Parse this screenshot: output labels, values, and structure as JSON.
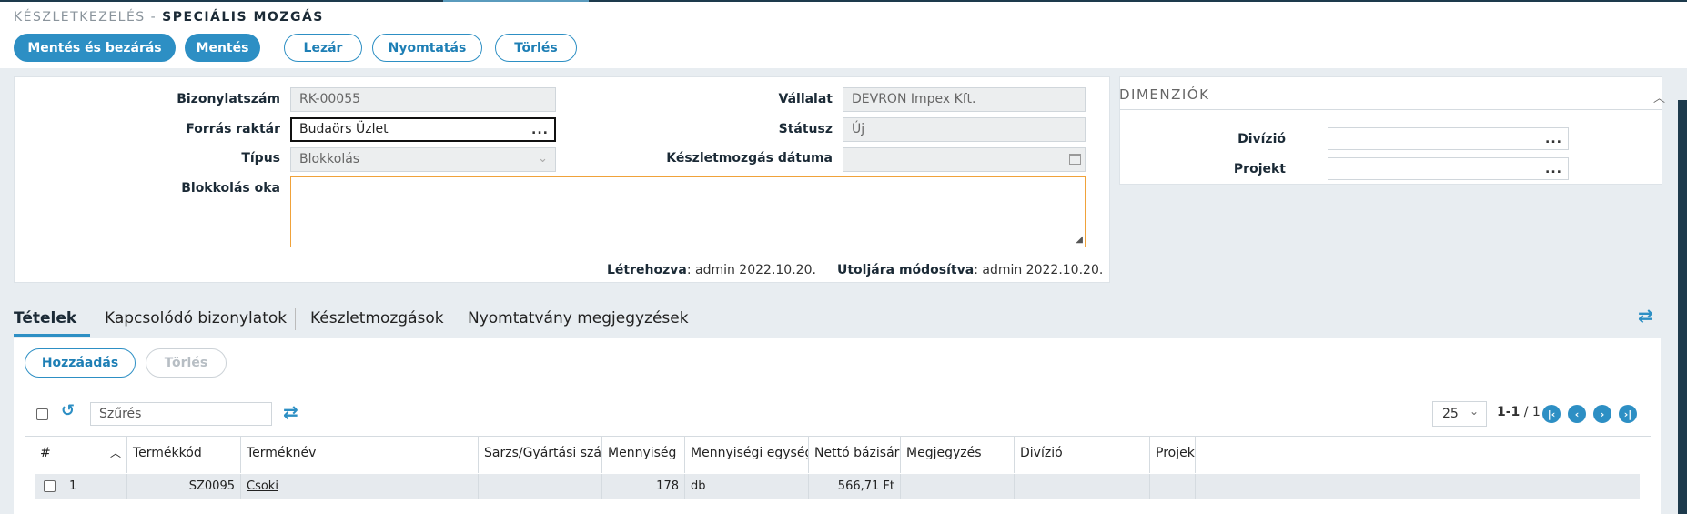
{
  "header": {
    "breadcrumb": "KÉSZLETKEZELÉS -",
    "title": "SPECIÁLIS MOZGÁS"
  },
  "toolbar": {
    "save_close": "Mentés és bezárás",
    "save": "Mentés",
    "close_doc": "Lezár",
    "print": "Nyomtatás",
    "delete": "Törlés"
  },
  "form": {
    "doc_number_label": "Bizonylatszám",
    "doc_number_value": "RK-00055",
    "source_wh_label": "Forrás raktár",
    "source_wh_value": "Budaörs Üzlet",
    "type_label": "Típus",
    "type_value": "Blokkolás",
    "reason_label": "Blokkolás oka",
    "reason_value": "",
    "company_label": "Vállalat",
    "company_value": "DEVRON Impex Kft.",
    "status_label": "Státusz",
    "status_value": "Új",
    "date_label": "Készletmozgás dátuma",
    "date_value": "",
    "created_label": "Létrehozva",
    "created_value": ": admin 2022.10.20.",
    "modified_label": "Utoljára módosítva",
    "modified_value": ": admin 2022.10.20."
  },
  "dimensions": {
    "title": "DIMENZIÓK",
    "division_label": "Divízió",
    "project_label": "Projekt"
  },
  "tabs": [
    {
      "label": "Tételek"
    },
    {
      "label": "Kapcsolódó bizonylatok"
    },
    {
      "label": "Készletmozgások"
    },
    {
      "label": "Nyomtatvány megjegyzések"
    }
  ],
  "grid": {
    "add": "Hozzáadás",
    "delete": "Törlés",
    "filter_placeholder": "Szűrés",
    "page_size": "25",
    "range": "1-1",
    "total": " / 1",
    "columns": [
      "#",
      "Termékkód",
      "Terméknév",
      "Sarzs/Gyártási szám",
      "Mennyiség",
      "Mennyiségi egység",
      "Nettó bázisár",
      "Megjegyzés",
      "Divízió",
      "Projekt"
    ],
    "rows": [
      {
        "num": "1",
        "code": "SZ0095",
        "name": "Csoki",
        "batch": "",
        "qty": "178",
        "unit": "db",
        "price": "566,71 Ft",
        "note": "",
        "division": "",
        "project": ""
      }
    ]
  },
  "colors": {
    "accent": "#2d8fc4",
    "dark": "#1d3a4c",
    "focus": "#f0a23a"
  },
  "icons": [
    "refresh-icon",
    "swap-icon",
    "calendar-icon",
    "chevron-down-icon",
    "chevron-up-icon",
    "sort-icon"
  ]
}
